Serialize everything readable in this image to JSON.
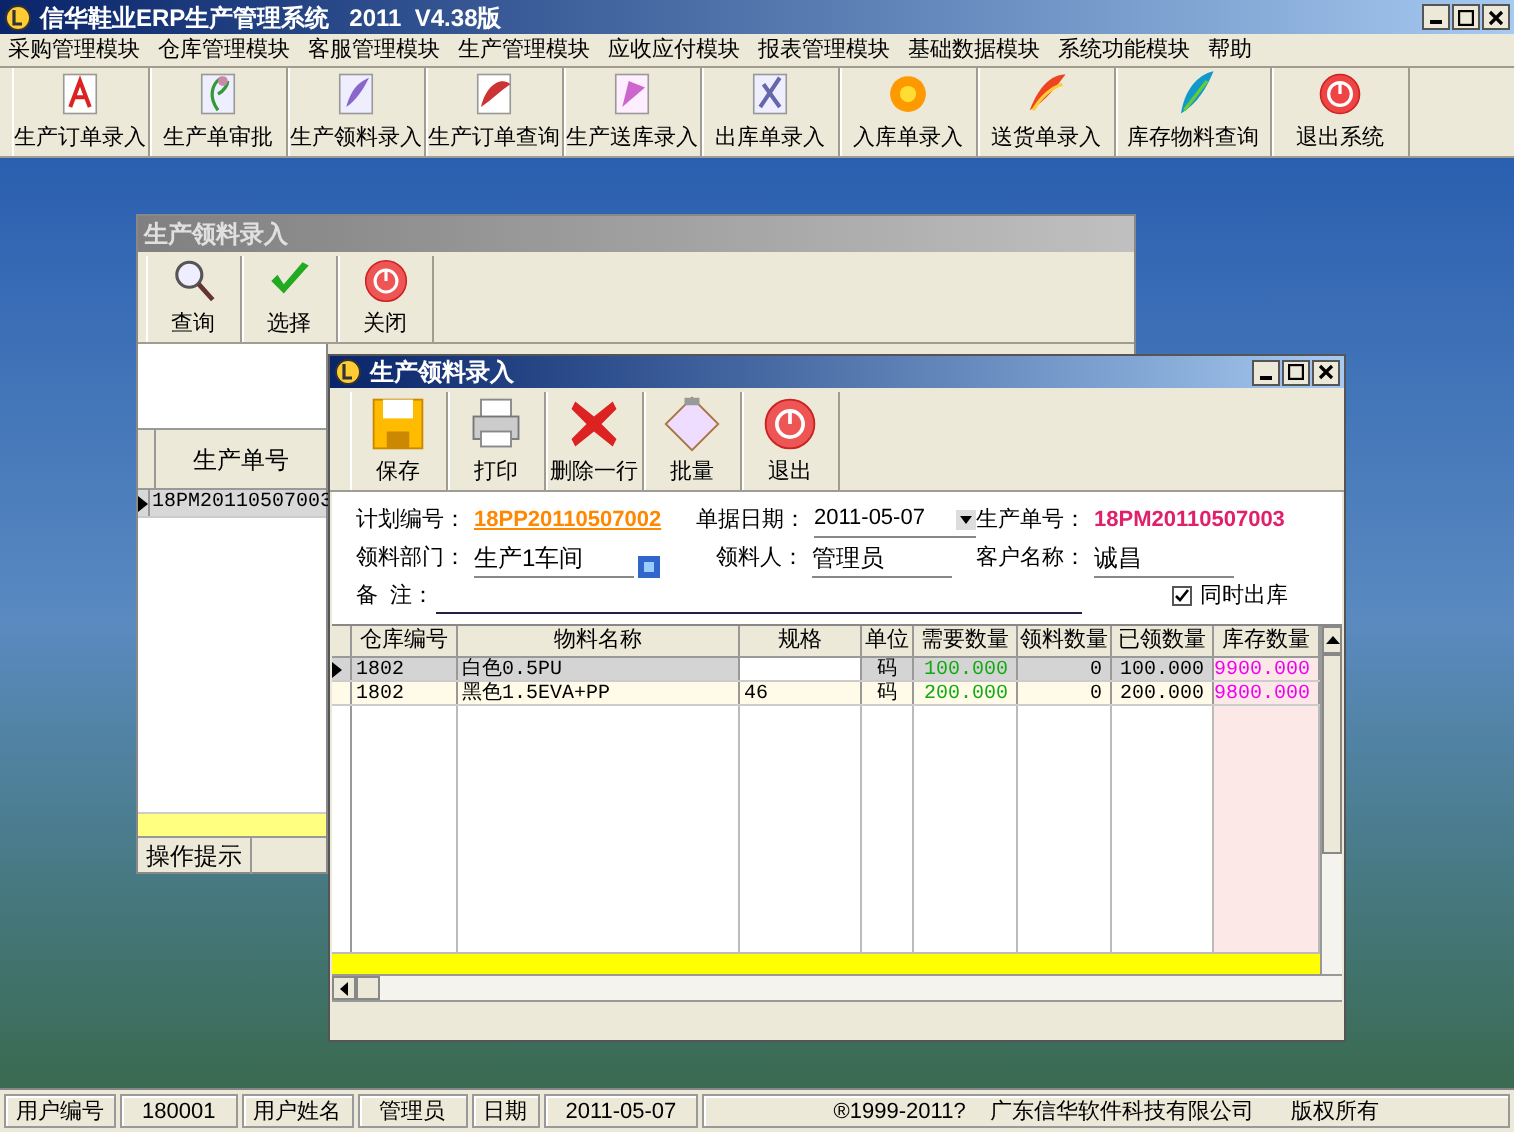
{
  "window": {
    "title": "信华鞋业ERP生产管理系统   2011  V4.38版"
  },
  "menu": [
    "采购管理模块",
    "仓库管理模块",
    "客服管理模块",
    "生产管理模块",
    "应收应付模块",
    "报表管理模块",
    "基础数据模块",
    "系统功能模块",
    "帮助"
  ],
  "toolbar": [
    "生产订单录入",
    "生产单审批",
    "生产领料录入",
    "生产订单查询",
    "生产送库录入",
    "出库单录入",
    "入库单录入",
    "送货单录入",
    "库存物料查询",
    "退出系统"
  ],
  "back_window": {
    "title": "生产领料录入",
    "toolbar": [
      "查询",
      "选择",
      "关闭"
    ],
    "column": "生产单号",
    "rows": [
      {
        "value": "18PM20110507003",
        "selected": true
      }
    ],
    "status": "操作提示"
  },
  "front_window": {
    "title": "生产领料录入",
    "toolbar": [
      "保存",
      "打印",
      "删除一行",
      "批量",
      "退出"
    ],
    "fields": [
      {
        "label": "计划编号：",
        "value": "18PP20110507002",
        "kind": "link"
      },
      {
        "label": "单据日期：",
        "value": "2011-05-07",
        "kind": "date"
      },
      {
        "label": "生产单号：",
        "value": "18PM20110507003",
        "kind": "highlight"
      },
      {
        "label": "领料部门：",
        "value": "生产1车间",
        "kind": "lookup"
      },
      {
        "label": "领料人：",
        "value": "管理员",
        "kind": "text"
      },
      {
        "label": "客户名称：",
        "value": "诚昌",
        "kind": "text"
      },
      {
        "label": "备  注：",
        "kind": "note"
      }
    ],
    "checkbox": {
      "label": "同时出库",
      "checked": true
    },
    "columns": [
      "仓库编号",
      "物料名称",
      "规格",
      "单位",
      "需要数量",
      "领料数量",
      "已领数量",
      "库存数量"
    ],
    "rows": [
      {
        "selected": true,
        "cells": [
          "1802",
          "白色0.5PU",
          "",
          "码",
          "100.000",
          "0",
          "100.000",
          "9900.000"
        ]
      },
      {
        "selected": false,
        "cells": [
          "1802",
          "黑色1.5EVA+PP",
          "46",
          "码",
          "200.000",
          "0",
          "200.000",
          "9800.000"
        ]
      }
    ]
  },
  "status_bar": [
    "用户编号",
    "180001",
    "用户姓名",
    "管理员",
    "日期",
    "2011-05-07",
    "®1999-2011?    广东信华软件科技有限公司      版权所有"
  ]
}
